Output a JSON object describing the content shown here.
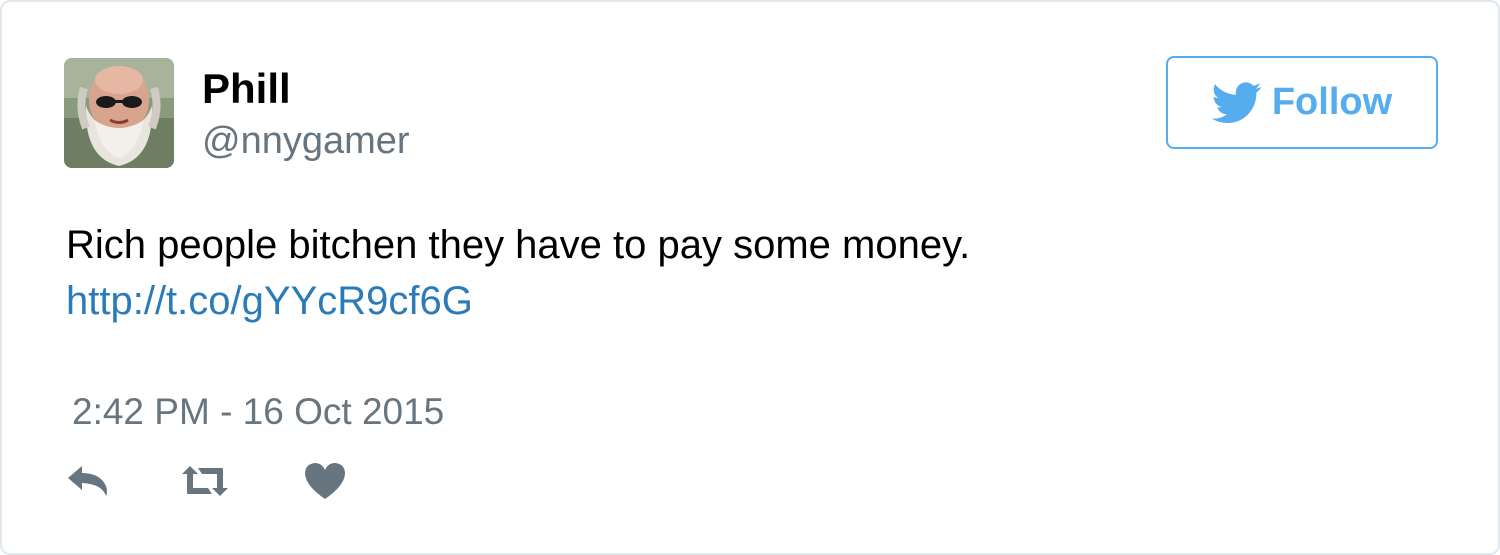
{
  "tweet": {
    "author": {
      "display_name": "Phill",
      "handle": "@nnygamer",
      "avatar_icon": "bearded-man-avatar"
    },
    "follow_button": {
      "label": "Follow",
      "icon": "twitter-bird-icon"
    },
    "text": "Rich people bitchen they have to pay some money.",
    "link": "http://t.co/gYYcR9cf6G",
    "timestamp": "2:42 PM - 16 Oct 2015",
    "actions": [
      {
        "name": "reply",
        "icon": "reply-icon"
      },
      {
        "name": "retweet",
        "icon": "retweet-icon"
      },
      {
        "name": "like",
        "icon": "heart-icon"
      }
    ]
  },
  "colors": {
    "brand_blue": "#55acee",
    "link_blue": "#2b7bb9",
    "muted_gray": "#66757f",
    "border": "#e1e8ed"
  }
}
